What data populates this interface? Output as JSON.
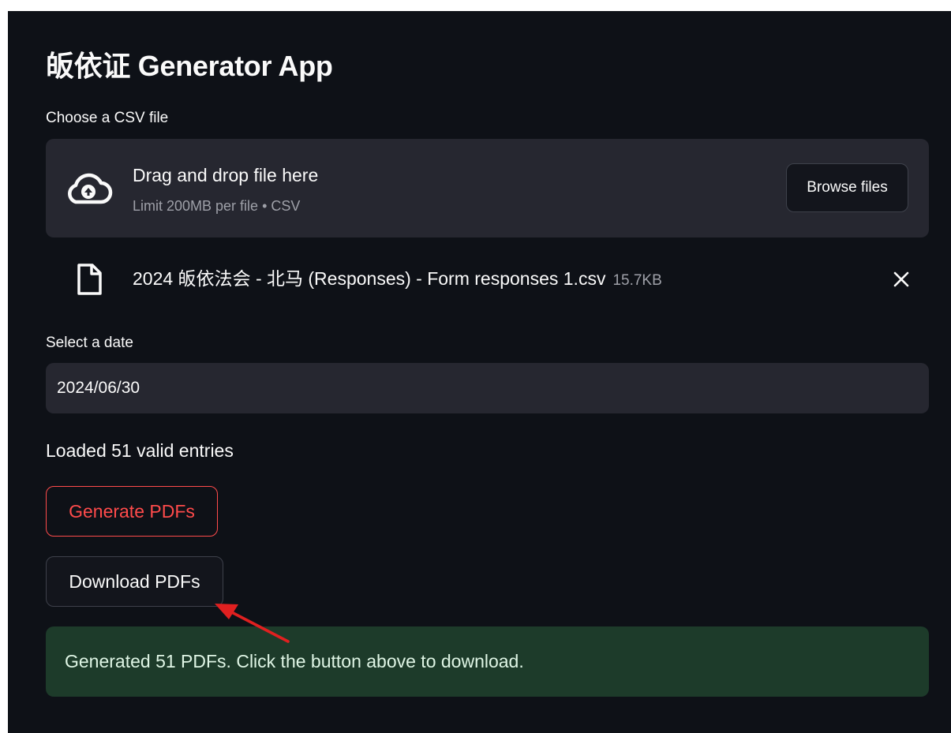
{
  "app": {
    "title": "皈依证 Generator App"
  },
  "uploader": {
    "label": "Choose a CSV file",
    "drag_text": "Drag and drop file here",
    "limit_text": "Limit 200MB per file • CSV",
    "browse_label": "Browse files",
    "icon": "cloud-upload-icon"
  },
  "uploaded_file": {
    "name": "2024 皈依法会 - 北马 (Responses) - Form responses 1.csv",
    "size": "15.7KB",
    "icon": "file-icon",
    "remove_icon": "close-icon"
  },
  "date_picker": {
    "label": "Select a date",
    "value": "2024/06/30"
  },
  "status": {
    "loaded_text": "Loaded 51 valid entries"
  },
  "buttons": {
    "generate_label": "Generate PDFs",
    "download_label": "Download PDFs"
  },
  "success": {
    "message": "Generated 51 PDFs. Click the button above to download."
  },
  "colors": {
    "background": "#0e1117",
    "panel": "#262730",
    "accent": "#ff4b4b",
    "success_bg": "#1d3b2a",
    "annotation_arrow": "#e02020"
  }
}
